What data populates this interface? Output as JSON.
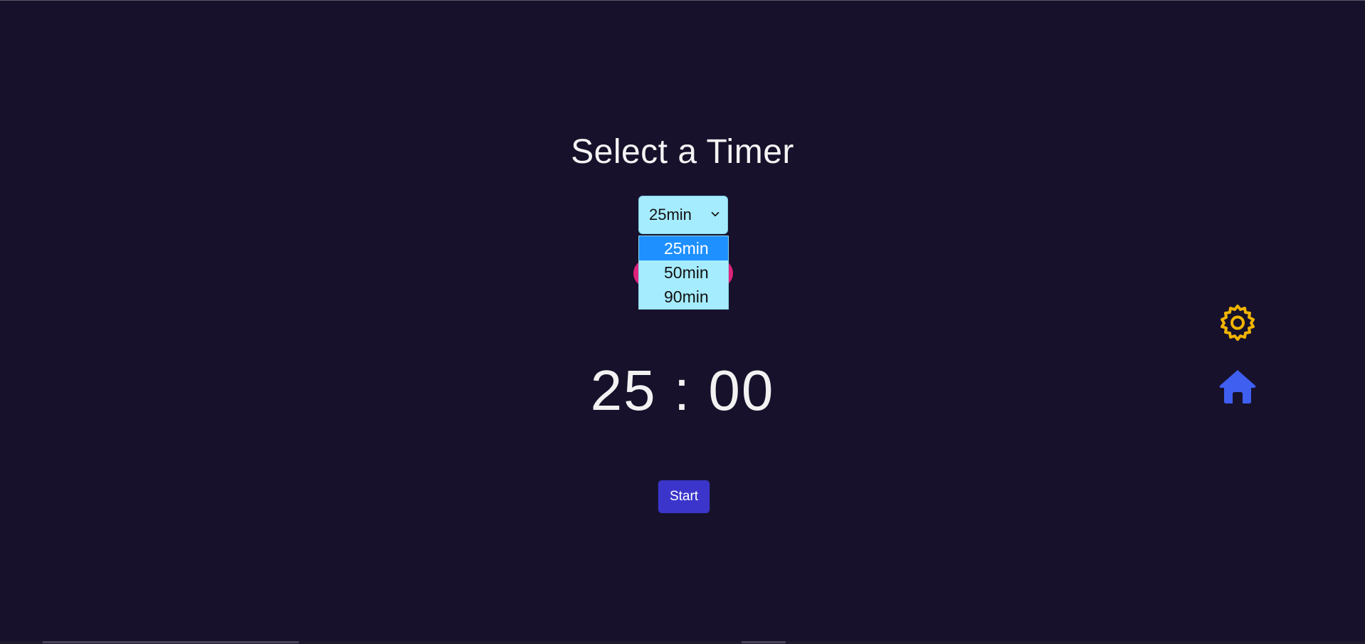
{
  "header": {
    "title": "Select a Timer"
  },
  "timer_select": {
    "selected": "25min",
    "options": [
      "25min",
      "50min",
      "90min"
    ]
  },
  "timer": {
    "display": "25 : 00"
  },
  "controls": {
    "start_label": "Start"
  },
  "icons": {
    "settings": "gear-icon",
    "home": "home-icon",
    "dropdown": "chevron-down-icon"
  },
  "colors": {
    "background": "#17112b",
    "select_bg": "#a6ecff",
    "option_selected_bg": "#1e90ff",
    "accent_pink": "#e0237a",
    "start_button": "#3b35cc",
    "gear": "#f0b400",
    "home": "#3f5ff0"
  }
}
